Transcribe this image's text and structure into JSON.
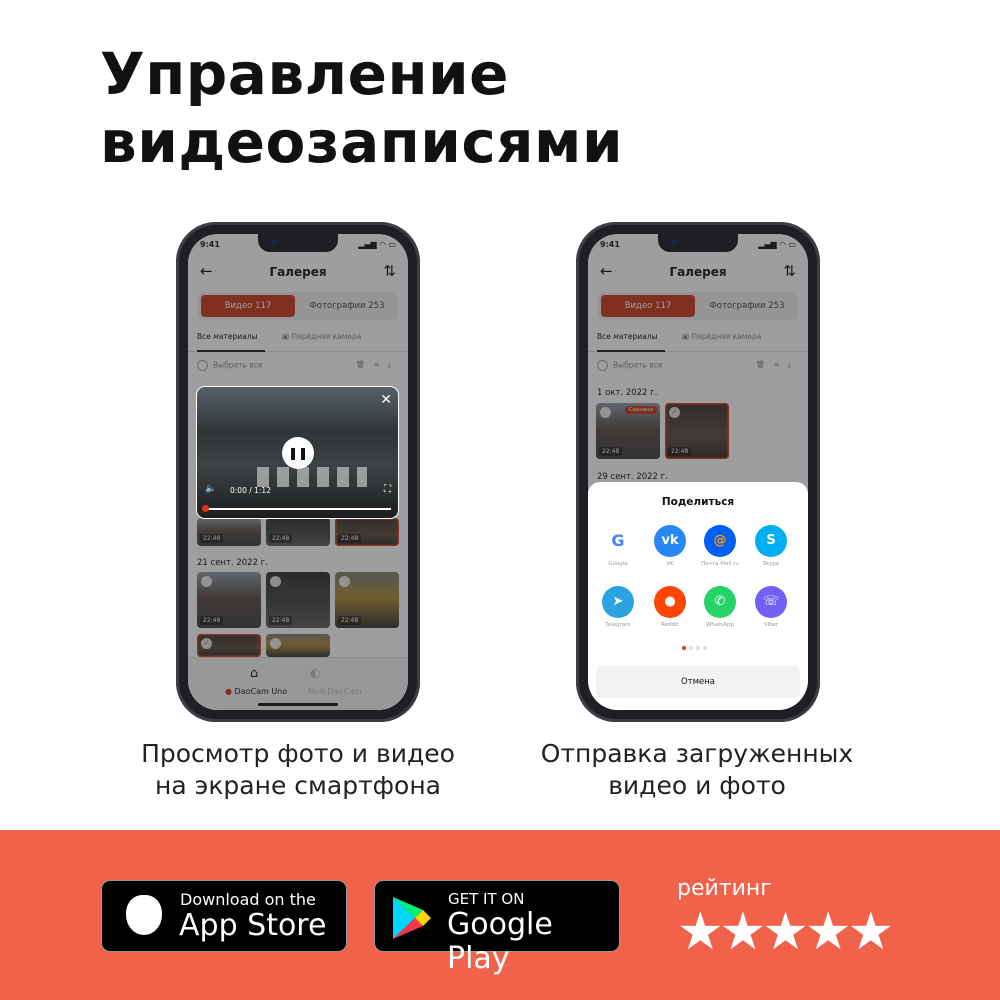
{
  "headline": [
    "Управление",
    "видеозаписями"
  ],
  "left_phone": {
    "status_time": "9:41",
    "header_title": "Галерея",
    "segments": [
      "Видео 117",
      "Фотографии 253"
    ],
    "subtabs": [
      "Все материалы",
      "Передняя камера"
    ],
    "select_all": "Выбрать все",
    "player": {
      "time": "0:00 / 1:12",
      "progress": 0
    },
    "thumb_time": "22:48",
    "date_group": "21 сент. 2022 г.",
    "nav": [
      "DaoCam Uno",
      "Мой DaoCam"
    ]
  },
  "right_phone": {
    "status_time": "9:41",
    "header_title": "Галерея",
    "segments": [
      "Видео 117",
      "Фотографии 253"
    ],
    "subtabs": [
      "Все материалы",
      "Передняя камера"
    ],
    "select_all": "Выбрать все",
    "date_groups": [
      "1 окт. 2022 г.",
      "29 сент. 2022 г."
    ],
    "downloaded_badge": "Скачано",
    "thumb_time": "22:48",
    "share": {
      "title": "Поделиться",
      "apps": [
        {
          "label": "Google",
          "color": "#ffffff"
        },
        {
          "label": "VK",
          "color": "#2787f5"
        },
        {
          "label": "Почта Mail.ru",
          "color": "#005ff9"
        },
        {
          "label": "Skype",
          "color": "#00aff0"
        },
        {
          "label": "Telegram",
          "color": "#2aa3e0"
        },
        {
          "label": "Reddit",
          "color": "#ff4500"
        },
        {
          "label": "WhatsApp",
          "color": "#25d366"
        },
        {
          "label": "Viber",
          "color": "#7360f2"
        }
      ],
      "page": 1,
      "pages": 4,
      "cancel": "Отмена"
    }
  },
  "captions": {
    "left": [
      "Просмотр фото и видео",
      "на экране смартфона"
    ],
    "right": [
      "Отправка загруженных",
      "видео и фото"
    ]
  },
  "app_store": {
    "small": "Download on the",
    "big": "App Store"
  },
  "google_play": {
    "small": "GET IT ON",
    "big": "Google Play"
  },
  "rating": {
    "label": "рейтинг",
    "value": 4.9,
    "max": 5
  },
  "colors": {
    "accent": "#c8371c",
    "band": "#f0624a"
  }
}
